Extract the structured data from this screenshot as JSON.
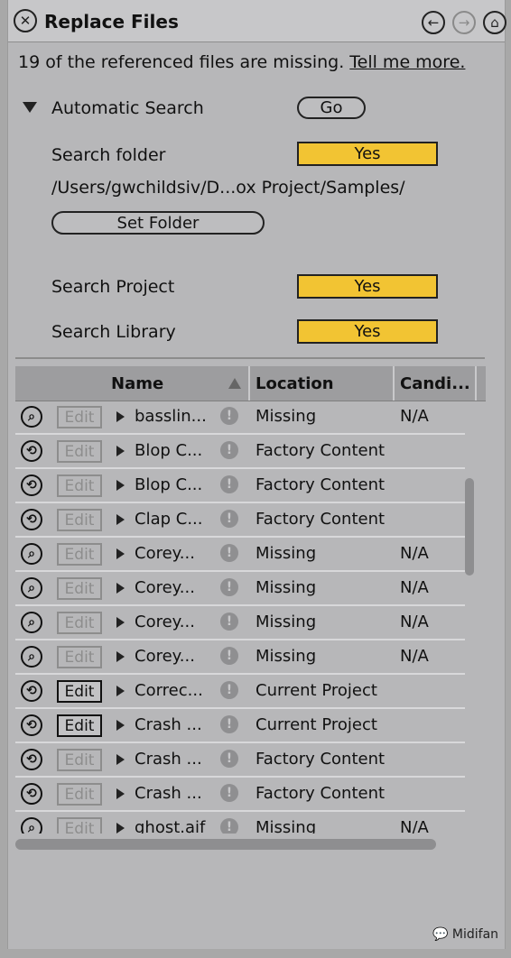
{
  "window": {
    "title": "Replace Files"
  },
  "message": {
    "text": "19 of the referenced files are missing.",
    "link": "Tell me more."
  },
  "auto_search": {
    "label": "Automatic Search",
    "go_label": "Go",
    "search_folder_label": "Search folder",
    "search_folder_value": "Yes",
    "folder_path": "/Users/gwchildsiv/D...ox Project/Samples/",
    "set_folder_label": "Set Folder",
    "search_project_label": "Search Project",
    "search_project_value": "Yes",
    "search_library_label": "Search Library",
    "search_library_value": "Yes"
  },
  "table": {
    "columns": [
      "Name",
      "Location",
      "Candi..."
    ],
    "edit_label": "Edit",
    "rows": [
      {
        "name": "basslin...",
        "location": "Missing",
        "candidates": "N/A",
        "icon": "search-icon",
        "edit_enabled": false
      },
      {
        "name": "Blop C...",
        "location": "Factory Content",
        "candidates": "",
        "icon": "replace-icon",
        "edit_enabled": false
      },
      {
        "name": "Blop C...",
        "location": "Factory Content",
        "candidates": "",
        "icon": "replace-icon",
        "edit_enabled": false
      },
      {
        "name": "Clap C...",
        "location": "Factory Content",
        "candidates": "",
        "icon": "replace-icon",
        "edit_enabled": false
      },
      {
        "name": "Corey...",
        "location": "Missing",
        "candidates": "N/A",
        "icon": "search-icon",
        "edit_enabled": false
      },
      {
        "name": "Corey...",
        "location": "Missing",
        "candidates": "N/A",
        "icon": "search-icon",
        "edit_enabled": false
      },
      {
        "name": "Corey...",
        "location": "Missing",
        "candidates": "N/A",
        "icon": "search-icon",
        "edit_enabled": false
      },
      {
        "name": "Corey...",
        "location": "Missing",
        "candidates": "N/A",
        "icon": "search-icon",
        "edit_enabled": false
      },
      {
        "name": "Correc...",
        "location": "Current Project",
        "candidates": "",
        "icon": "replace-icon",
        "edit_enabled": true
      },
      {
        "name": "Crash ...",
        "location": "Current Project",
        "candidates": "",
        "icon": "replace-icon",
        "edit_enabled": true
      },
      {
        "name": "Crash ...",
        "location": "Factory Content",
        "candidates": "",
        "icon": "replace-icon",
        "edit_enabled": false
      },
      {
        "name": "Crash ...",
        "location": "Factory Content",
        "candidates": "",
        "icon": "replace-icon",
        "edit_enabled": false
      },
      {
        "name": "ghost.aif",
        "location": "Missing",
        "candidates": "N/A",
        "icon": "search-icon",
        "edit_enabled": false
      }
    ]
  },
  "watermark": "Midifan",
  "colors": {
    "toggle_on": "#f2c433",
    "panel": "#b7b7b9"
  }
}
